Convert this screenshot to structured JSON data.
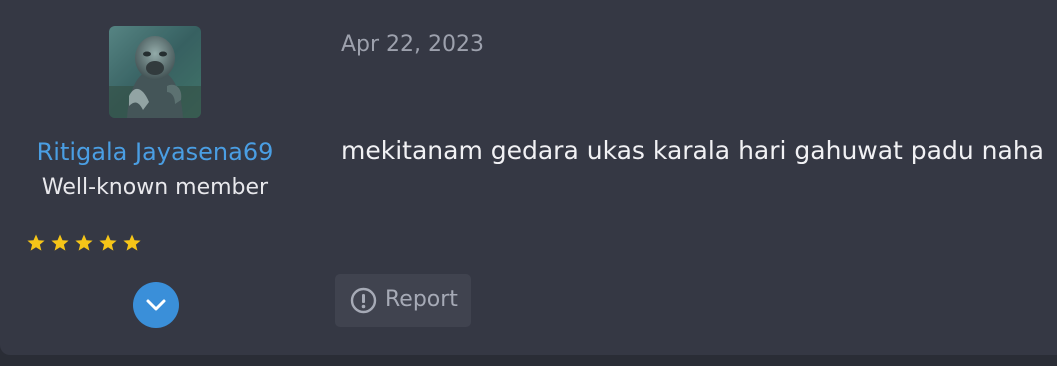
{
  "post": {
    "author": {
      "avatar_icon": "gorilla-avatar",
      "name": "Ritigala Jayasena69",
      "title": "Well-known member",
      "rating_stars": 5,
      "name_color": "#4a9ee3"
    },
    "date": "Apr 22, 2023",
    "message": "mekitanam gedara ukas karala hari gahuwat padu naha",
    "actions": {
      "report_label": "Report",
      "report_icon": "exclamation-circle-icon",
      "expand_icon": "chevron-down-icon"
    },
    "colors": {
      "background": "#353844",
      "accent": "#3a8fd9",
      "star": "#f5c518"
    }
  }
}
